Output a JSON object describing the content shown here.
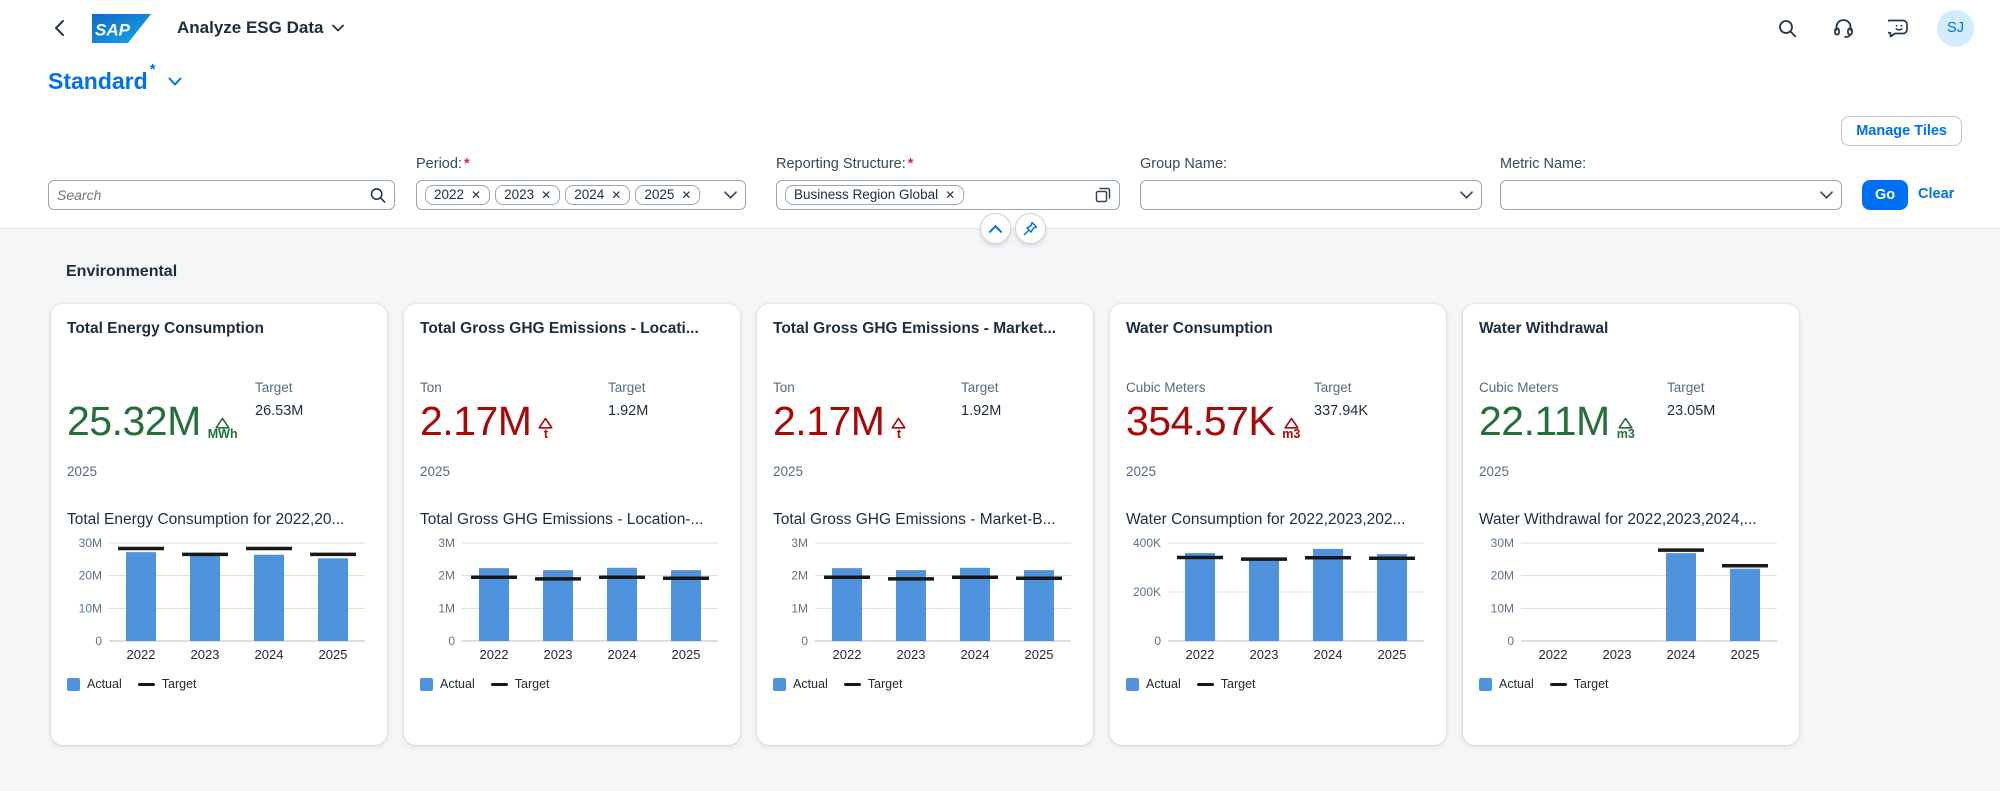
{
  "colors": {
    "accent": "#0070f2",
    "bar": "#4f93dc",
    "positive": "#256f3a",
    "negative": "#aa0808",
    "target_line": "#16181a"
  },
  "shell": {
    "title": "Analyze ESG Data",
    "logo_text": "SAP",
    "avatar_initials": "SJ"
  },
  "variant": {
    "title": "Standard",
    "dirty_marker": "*"
  },
  "actions": {
    "manage_tiles": "Manage Tiles",
    "go": "Go",
    "clear": "Clear"
  },
  "filters": {
    "search": {
      "placeholder": "Search"
    },
    "period": {
      "label": "Period:",
      "tokens": [
        "2022",
        "2023",
        "2024",
        "2025"
      ]
    },
    "reporting_structure": {
      "label": "Reporting Structure:",
      "tokens": [
        "Business Region Global"
      ]
    },
    "group_name": {
      "label": "Group Name:",
      "value": ""
    },
    "metric_name": {
      "label": "Metric Name:",
      "value": ""
    }
  },
  "section": {
    "title": "Environmental"
  },
  "legend": {
    "actual": "Actual",
    "target": "Target"
  },
  "tiles": [
    {
      "title": "Total Energy Consumption",
      "unit": "",
      "value": "25.32M",
      "value_state": "good",
      "deviation_unit": "MWh",
      "target_label": "Target",
      "target_value": "26.53M",
      "year": "2025",
      "chart_title": "Total Energy Consumption for 2022,20..."
    },
    {
      "title": "Total Gross GHG Emissions - Locati...",
      "unit": "Ton",
      "value": "2.17M",
      "value_state": "bad",
      "deviation_unit": "t",
      "target_label": "Target",
      "target_value": "1.92M",
      "year": "2025",
      "chart_title": "Total Gross GHG Emissions - Location-..."
    },
    {
      "title": "Total Gross GHG Emissions - Market...",
      "unit": "Ton",
      "value": "2.17M",
      "value_state": "bad",
      "deviation_unit": "t",
      "target_label": "Target",
      "target_value": "1.92M",
      "year": "2025",
      "chart_title": "Total Gross GHG Emissions - Market-B..."
    },
    {
      "title": "Water Consumption",
      "unit": "Cubic Meters",
      "value": "354.57K",
      "value_state": "bad",
      "deviation_unit": "m3",
      "target_label": "Target",
      "target_value": "337.94K",
      "year": "2025",
      "chart_title": "Water Consumption for 2022,2023,202..."
    },
    {
      "title": "Water Withdrawal",
      "unit": "Cubic Meters",
      "value": "22.11M",
      "value_state": "good",
      "deviation_unit": "m3",
      "target_label": "Target",
      "target_value": "23.05M",
      "year": "2025",
      "chart_title": "Water Withdrawal for 2022,2023,2024,..."
    }
  ],
  "chart_data": [
    {
      "type": "bar",
      "title": "Total Energy Consumption for 2022,20...",
      "categories": [
        "2022",
        "2023",
        "2024",
        "2025"
      ],
      "series": [
        {
          "name": "Actual",
          "values": [
            27.2,
            26.3,
            26.4,
            25.32
          ]
        },
        {
          "name": "Target",
          "values": [
            28.3,
            26.5,
            28.3,
            26.53
          ]
        }
      ],
      "ylabel": "MWh",
      "ylim": [
        0,
        30
      ],
      "yticks": [
        {
          "v": 0,
          "label": "0"
        },
        {
          "v": 10,
          "label": "10M"
        },
        {
          "v": 20,
          "label": "20M"
        },
        {
          "v": 30,
          "label": "30M"
        }
      ],
      "grid": true,
      "legend_position": "bottom"
    },
    {
      "type": "bar",
      "title": "Total Gross GHG Emissions - Location-...",
      "categories": [
        "2022",
        "2023",
        "2024",
        "2025"
      ],
      "series": [
        {
          "name": "Actual",
          "values": [
            2.23,
            2.17,
            2.24,
            2.17
          ]
        },
        {
          "name": "Target",
          "values": [
            1.95,
            1.9,
            1.95,
            1.92
          ]
        }
      ],
      "ylabel": "Ton",
      "ylim": [
        0,
        3
      ],
      "yticks": [
        {
          "v": 0,
          "label": "0"
        },
        {
          "v": 1,
          "label": "1M"
        },
        {
          "v": 2,
          "label": "2M"
        },
        {
          "v": 3,
          "label": "3M"
        }
      ],
      "grid": true,
      "legend_position": "bottom"
    },
    {
      "type": "bar",
      "title": "Total Gross GHG Emissions - Market-B...",
      "categories": [
        "2022",
        "2023",
        "2024",
        "2025"
      ],
      "series": [
        {
          "name": "Actual",
          "values": [
            2.23,
            2.17,
            2.24,
            2.17
          ]
        },
        {
          "name": "Target",
          "values": [
            1.95,
            1.9,
            1.95,
            1.92
          ]
        }
      ],
      "ylabel": "Ton",
      "ylim": [
        0,
        3
      ],
      "yticks": [
        {
          "v": 0,
          "label": "0"
        },
        {
          "v": 1,
          "label": "1M"
        },
        {
          "v": 2,
          "label": "2M"
        },
        {
          "v": 3,
          "label": "3M"
        }
      ],
      "grid": true,
      "legend_position": "bottom"
    },
    {
      "type": "bar",
      "title": "Water Consumption for 2022,2023,202...",
      "categories": [
        "2022",
        "2023",
        "2024",
        "2025"
      ],
      "series": [
        {
          "name": "Actual",
          "values": [
            359,
            333,
            376,
            354.57
          ]
        },
        {
          "name": "Target",
          "values": [
            341,
            334,
            340,
            337.94
          ]
        }
      ],
      "ylabel": "Cubic Meters",
      "ylim": [
        0,
        400
      ],
      "yticks": [
        {
          "v": 0,
          "label": "0"
        },
        {
          "v": 200,
          "label": "200K"
        },
        {
          "v": 400,
          "label": "400K"
        }
      ],
      "grid": true,
      "legend_position": "bottom"
    },
    {
      "type": "bar",
      "title": "Water Withdrawal for 2022,2023,2024,...",
      "categories": [
        "2022",
        "2023",
        "2024",
        "2025"
      ],
      "series": [
        {
          "name": "Actual",
          "values": [
            0,
            0,
            26.9,
            22.11
          ]
        },
        {
          "name": "Target",
          "values": [
            null,
            null,
            27.8,
            23.05
          ]
        }
      ],
      "ylabel": "Cubic Meters",
      "ylim": [
        0,
        30
      ],
      "yticks": [
        {
          "v": 0,
          "label": "0"
        },
        {
          "v": 10,
          "label": "10M"
        },
        {
          "v": 20,
          "label": "20M"
        },
        {
          "v": 30,
          "label": "30M"
        }
      ],
      "grid": true,
      "legend_position": "bottom"
    }
  ]
}
